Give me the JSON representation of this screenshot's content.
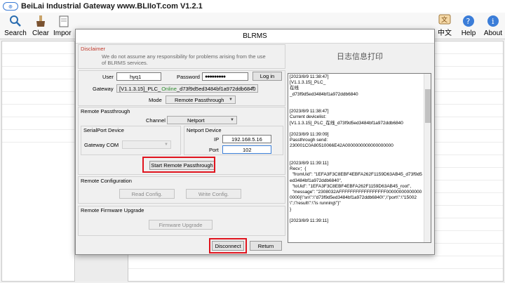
{
  "app": {
    "title": "BeiLai Industrial Gateway www.BLIIoT.com V1.2.1",
    "logo_text": "BLIIoT"
  },
  "toolbar": {
    "left": [
      {
        "label": "Search",
        "icon": "search-icon"
      },
      {
        "label": "Clear",
        "icon": "clear-icon"
      },
      {
        "label": "Impor",
        "icon": "import-icon"
      }
    ],
    "right": [
      {
        "label": "中文",
        "icon": "language-icon"
      },
      {
        "label": "Help",
        "icon": "help-icon"
      },
      {
        "label": "About",
        "icon": "about-icon"
      }
    ]
  },
  "dialog": {
    "title": "BLRMS",
    "disclaimer": {
      "title": "Disclaimer",
      "text": "We do not assume any responsibility for problems arising from the use of BLRMS services."
    },
    "login": {
      "user_label": "User",
      "user_value": "hyq1",
      "password_label": "Password",
      "password_value": "●●●●●●●●●",
      "login_button": "Log in",
      "gateway_label": "Gateway",
      "gateway_prefix": "[V1.1.3.15]_PLC_",
      "gateway_status": "Online",
      "gateway_id": "_d73f9d5ed3484bf1a972ddb6840",
      "mode_label": "Mode",
      "mode_value": "Remote Passthrough"
    },
    "passthrough": {
      "title": "Remote Passthrough",
      "channel_label": "Channel",
      "channel_value": "Netport",
      "serial_title": "SerialPort Device",
      "gateway_com_label": "Gateway COM",
      "gateway_com_value": "",
      "netport_title": "Netport Device",
      "ip_label": "IP",
      "ip_value": "192.168.5.16",
      "port_label": "Port",
      "port_value": "102",
      "start_button": "Start Remote Passthrough"
    },
    "configuration": {
      "title": "Remote Configuration",
      "read_button": "Read Config.",
      "write_button": "Write Config."
    },
    "firmware": {
      "title": "Remote Firmware Upgrade",
      "upgrade_button": "Firmware Upgrade"
    },
    "footer": {
      "disconnect_button": "Disconnect",
      "return_button": "Return"
    },
    "log": {
      "title": "日志信息打印",
      "text": "[2023/8/9 11:38:47]\n[V1.1.3.15]_PLC_\n在线\n_d73f9d5ed3484bf1a972ddb6840\n\n\n[2023/8/9 11:38:47]\nCurrent devicelist:\n[V1.1.3.15]_PLC_在线_d73f9d5ed3484bf1a972ddb6840\n\n[2023/8/9 11:39:09]\nPassthrough send:\n230001C0A80510066E42A0000000000000000000\n\n\n[2023/8/9 11:39:11]\nRecv：{\n  \"fromUid\": \"1EFA3F3C8EBF4EBFA262F1159D63AB45_d73f9d5ed3484bf1a972ddb6840\",\n  \"toUid\": \"1EFA3F3C8EBF4EBFA262F1159D63AB45_root\",\n  \"message\": \"2308032AFFFFFFFFFFFFFFFFF000000000000000000{\\\"sn\\\":\\\"d73f9d5ed3484bf1a972ddb6840\\\",\\\"port\\\":\\\"15002\\\",\\\"result\\\":\\\"is running\\\"}\"\n}\n\n[2023/8/9 11:39:11]"
    }
  },
  "colors": {
    "highlight_box": "#e0141e",
    "online_text": "#2e8b2e",
    "disclaimer_title": "#c0392b"
  }
}
